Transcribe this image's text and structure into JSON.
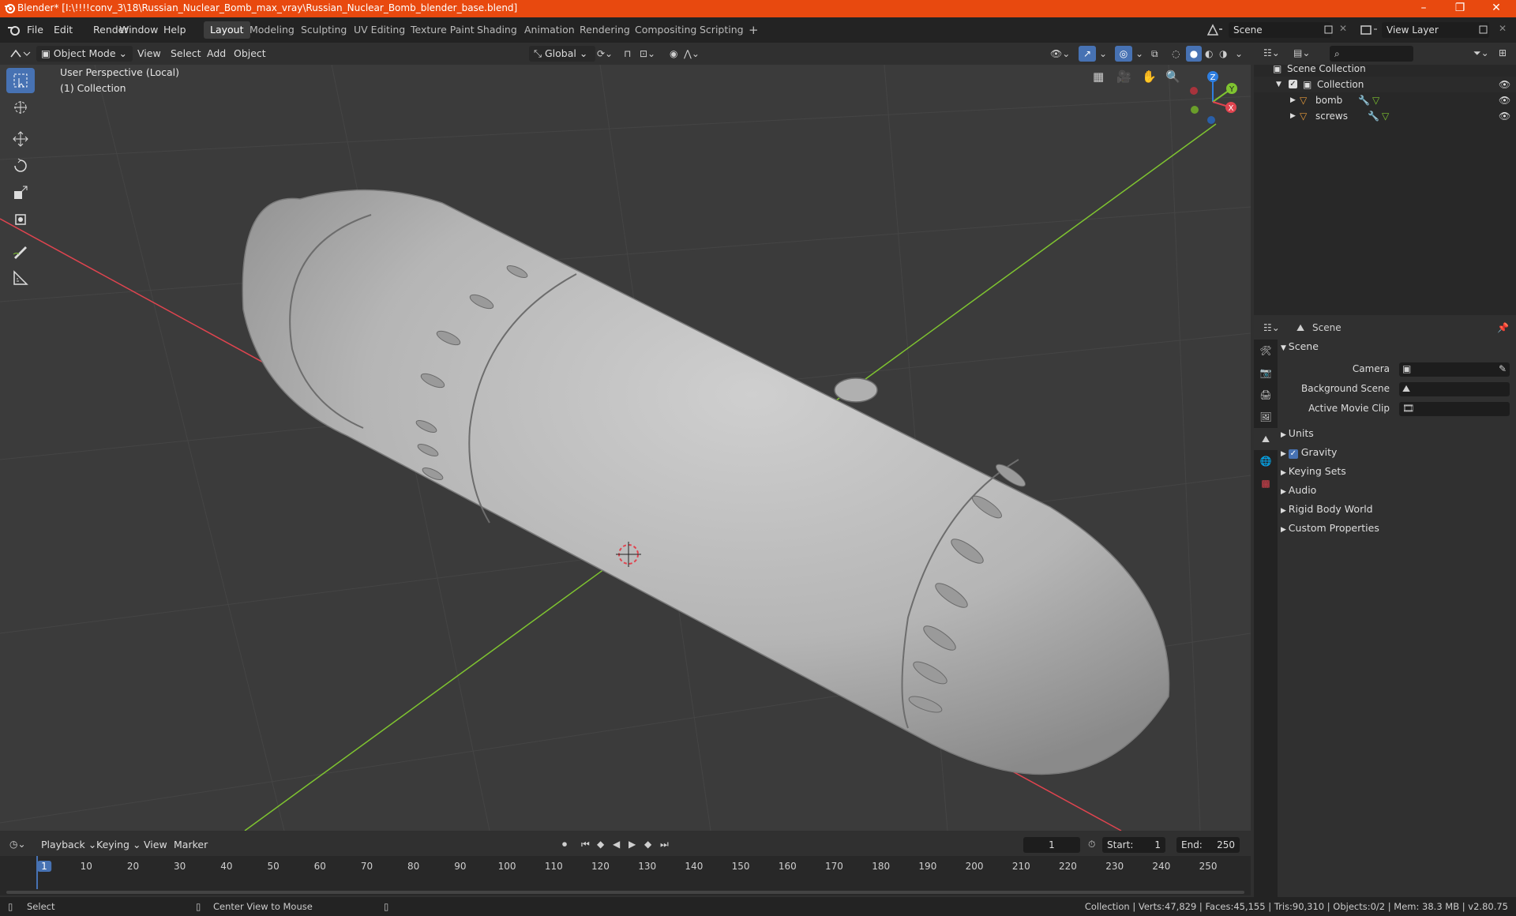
{
  "window": {
    "title": "Blender* [I:\\!!!!conv_3\\18\\Russian_Nuclear_Bomb_max_vray\\Russian_Nuclear_Bomb_blender_base.blend]",
    "minimize": "–",
    "maximize": "❐",
    "close": "✕"
  },
  "menu": [
    "File",
    "Edit",
    "Render",
    "Window",
    "Help"
  ],
  "workspaces": [
    "Layout",
    "Modeling",
    "Sculpting",
    "UV Editing",
    "Texture Paint",
    "Shading",
    "Animation",
    "Rendering",
    "Compositing",
    "Scripting"
  ],
  "active_workspace": "Layout",
  "add_workspace": "+",
  "scene_field": "Scene",
  "view_layer_field": "View Layer",
  "viewport_header": {
    "mode": "Object Mode",
    "menus": [
      "View",
      "Select",
      "Add",
      "Object"
    ],
    "orientation": "Global"
  },
  "viewport": {
    "perspective_label": "User Perspective (Local)",
    "collection_label": "(1) Collection",
    "gizmo": {
      "x": "X",
      "y": "Y",
      "z": "Z"
    }
  },
  "outliner": {
    "root": "Scene Collection",
    "collection": "Collection",
    "objects": [
      "bomb",
      "screws"
    ]
  },
  "properties": {
    "header": "Scene",
    "panel_title": "Scene",
    "fields": [
      {
        "label": "Camera",
        "value": ""
      },
      {
        "label": "Background Scene",
        "value": ""
      },
      {
        "label": "Active Movie Clip",
        "value": ""
      }
    ],
    "sections": [
      "Units",
      "Gravity",
      "Keying Sets",
      "Audio",
      "Rigid Body World",
      "Custom Properties"
    ],
    "gravity_checked": true
  },
  "timeline": {
    "menus": [
      "Playback",
      "Keying",
      "View",
      "Marker"
    ],
    "current_frame": "1",
    "start_label": "Start:",
    "start": "1",
    "end_label": "End:",
    "end": "250",
    "ticks": [
      "1",
      "10",
      "20",
      "30",
      "40",
      "50",
      "60",
      "70",
      "80",
      "90",
      "100",
      "110",
      "120",
      "130",
      "140",
      "150",
      "160",
      "170",
      "180",
      "190",
      "200",
      "210",
      "220",
      "230",
      "240",
      "250"
    ]
  },
  "statusbar": {
    "left": "Select",
    "middle": "Center View to Mouse",
    "right": "Collection | Verts:47,829 | Faces:45,155 | Tris:90,310 | Objects:0/2 | Mem: 38.3 MB | v2.80.75"
  },
  "colors": {
    "titlebar": "#e8490f",
    "accent": "#4772b3",
    "x_axis": "#e0444f",
    "y_axis": "#7fc430",
    "z_axis": "#2e7ee0",
    "mesh": "#bdbdbd"
  }
}
